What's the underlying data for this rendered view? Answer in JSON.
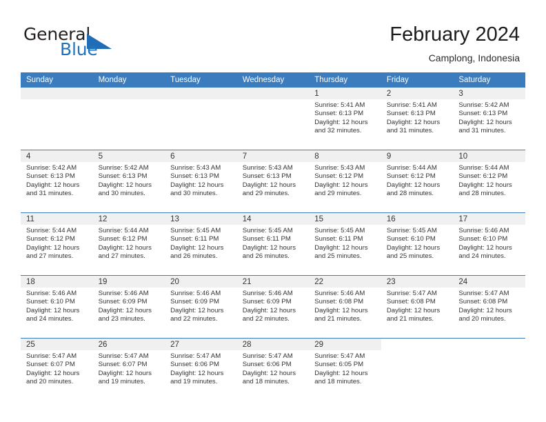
{
  "brand": {
    "word_one": "General",
    "word_two": "Blue",
    "triangle_icon": "triangle-icon"
  },
  "header": {
    "title": "February 2024",
    "location": "Camplong, Indonesia"
  },
  "colors": {
    "header_blue": "#3a7cbe",
    "brand_blue": "#1f72bd",
    "daynum_band": "#f0f0f0",
    "text": "#333333"
  },
  "weekday_headers": [
    "Sunday",
    "Monday",
    "Tuesday",
    "Wednesday",
    "Thursday",
    "Friday",
    "Saturday"
  ],
  "weeks": [
    [
      {
        "day": "",
        "empty": true
      },
      {
        "day": "",
        "empty": true
      },
      {
        "day": "",
        "empty": true
      },
      {
        "day": "",
        "empty": true
      },
      {
        "day": "1",
        "sunrise": "Sunrise: 5:41 AM",
        "sunset": "Sunset: 6:13 PM",
        "daylight_1": "Daylight: 12 hours",
        "daylight_2": "and 32 minutes."
      },
      {
        "day": "2",
        "sunrise": "Sunrise: 5:41 AM",
        "sunset": "Sunset: 6:13 PM",
        "daylight_1": "Daylight: 12 hours",
        "daylight_2": "and 31 minutes."
      },
      {
        "day": "3",
        "sunrise": "Sunrise: 5:42 AM",
        "sunset": "Sunset: 6:13 PM",
        "daylight_1": "Daylight: 12 hours",
        "daylight_2": "and 31 minutes."
      }
    ],
    [
      {
        "day": "4",
        "sunrise": "Sunrise: 5:42 AM",
        "sunset": "Sunset: 6:13 PM",
        "daylight_1": "Daylight: 12 hours",
        "daylight_2": "and 31 minutes."
      },
      {
        "day": "5",
        "sunrise": "Sunrise: 5:42 AM",
        "sunset": "Sunset: 6:13 PM",
        "daylight_1": "Daylight: 12 hours",
        "daylight_2": "and 30 minutes."
      },
      {
        "day": "6",
        "sunrise": "Sunrise: 5:43 AM",
        "sunset": "Sunset: 6:13 PM",
        "daylight_1": "Daylight: 12 hours",
        "daylight_2": "and 30 minutes."
      },
      {
        "day": "7",
        "sunrise": "Sunrise: 5:43 AM",
        "sunset": "Sunset: 6:13 PM",
        "daylight_1": "Daylight: 12 hours",
        "daylight_2": "and 29 minutes."
      },
      {
        "day": "8",
        "sunrise": "Sunrise: 5:43 AM",
        "sunset": "Sunset: 6:12 PM",
        "daylight_1": "Daylight: 12 hours",
        "daylight_2": "and 29 minutes."
      },
      {
        "day": "9",
        "sunrise": "Sunrise: 5:44 AM",
        "sunset": "Sunset: 6:12 PM",
        "daylight_1": "Daylight: 12 hours",
        "daylight_2": "and 28 minutes."
      },
      {
        "day": "10",
        "sunrise": "Sunrise: 5:44 AM",
        "sunset": "Sunset: 6:12 PM",
        "daylight_1": "Daylight: 12 hours",
        "daylight_2": "and 28 minutes."
      }
    ],
    [
      {
        "day": "11",
        "sunrise": "Sunrise: 5:44 AM",
        "sunset": "Sunset: 6:12 PM",
        "daylight_1": "Daylight: 12 hours",
        "daylight_2": "and 27 minutes."
      },
      {
        "day": "12",
        "sunrise": "Sunrise: 5:44 AM",
        "sunset": "Sunset: 6:12 PM",
        "daylight_1": "Daylight: 12 hours",
        "daylight_2": "and 27 minutes."
      },
      {
        "day": "13",
        "sunrise": "Sunrise: 5:45 AM",
        "sunset": "Sunset: 6:11 PM",
        "daylight_1": "Daylight: 12 hours",
        "daylight_2": "and 26 minutes."
      },
      {
        "day": "14",
        "sunrise": "Sunrise: 5:45 AM",
        "sunset": "Sunset: 6:11 PM",
        "daylight_1": "Daylight: 12 hours",
        "daylight_2": "and 26 minutes."
      },
      {
        "day": "15",
        "sunrise": "Sunrise: 5:45 AM",
        "sunset": "Sunset: 6:11 PM",
        "daylight_1": "Daylight: 12 hours",
        "daylight_2": "and 25 minutes."
      },
      {
        "day": "16",
        "sunrise": "Sunrise: 5:45 AM",
        "sunset": "Sunset: 6:10 PM",
        "daylight_1": "Daylight: 12 hours",
        "daylight_2": "and 25 minutes."
      },
      {
        "day": "17",
        "sunrise": "Sunrise: 5:46 AM",
        "sunset": "Sunset: 6:10 PM",
        "daylight_1": "Daylight: 12 hours",
        "daylight_2": "and 24 minutes."
      }
    ],
    [
      {
        "day": "18",
        "sunrise": "Sunrise: 5:46 AM",
        "sunset": "Sunset: 6:10 PM",
        "daylight_1": "Daylight: 12 hours",
        "daylight_2": "and 24 minutes."
      },
      {
        "day": "19",
        "sunrise": "Sunrise: 5:46 AM",
        "sunset": "Sunset: 6:09 PM",
        "daylight_1": "Daylight: 12 hours",
        "daylight_2": "and 23 minutes."
      },
      {
        "day": "20",
        "sunrise": "Sunrise: 5:46 AM",
        "sunset": "Sunset: 6:09 PM",
        "daylight_1": "Daylight: 12 hours",
        "daylight_2": "and 22 minutes."
      },
      {
        "day": "21",
        "sunrise": "Sunrise: 5:46 AM",
        "sunset": "Sunset: 6:09 PM",
        "daylight_1": "Daylight: 12 hours",
        "daylight_2": "and 22 minutes."
      },
      {
        "day": "22",
        "sunrise": "Sunrise: 5:46 AM",
        "sunset": "Sunset: 6:08 PM",
        "daylight_1": "Daylight: 12 hours",
        "daylight_2": "and 21 minutes."
      },
      {
        "day": "23",
        "sunrise": "Sunrise: 5:47 AM",
        "sunset": "Sunset: 6:08 PM",
        "daylight_1": "Daylight: 12 hours",
        "daylight_2": "and 21 minutes."
      },
      {
        "day": "24",
        "sunrise": "Sunrise: 5:47 AM",
        "sunset": "Sunset: 6:08 PM",
        "daylight_1": "Daylight: 12 hours",
        "daylight_2": "and 20 minutes."
      }
    ],
    [
      {
        "day": "25",
        "sunrise": "Sunrise: 5:47 AM",
        "sunset": "Sunset: 6:07 PM",
        "daylight_1": "Daylight: 12 hours",
        "daylight_2": "and 20 minutes."
      },
      {
        "day": "26",
        "sunrise": "Sunrise: 5:47 AM",
        "sunset": "Sunset: 6:07 PM",
        "daylight_1": "Daylight: 12 hours",
        "daylight_2": "and 19 minutes."
      },
      {
        "day": "27",
        "sunrise": "Sunrise: 5:47 AM",
        "sunset": "Sunset: 6:06 PM",
        "daylight_1": "Daylight: 12 hours",
        "daylight_2": "and 19 minutes."
      },
      {
        "day": "28",
        "sunrise": "Sunrise: 5:47 AM",
        "sunset": "Sunset: 6:06 PM",
        "daylight_1": "Daylight: 12 hours",
        "daylight_2": "and 18 minutes."
      },
      {
        "day": "29",
        "sunrise": "Sunrise: 5:47 AM",
        "sunset": "Sunset: 6:05 PM",
        "daylight_1": "Daylight: 12 hours",
        "daylight_2": "and 18 minutes."
      },
      {
        "day": "",
        "blank": true
      },
      {
        "day": "",
        "blank": true
      }
    ]
  ]
}
